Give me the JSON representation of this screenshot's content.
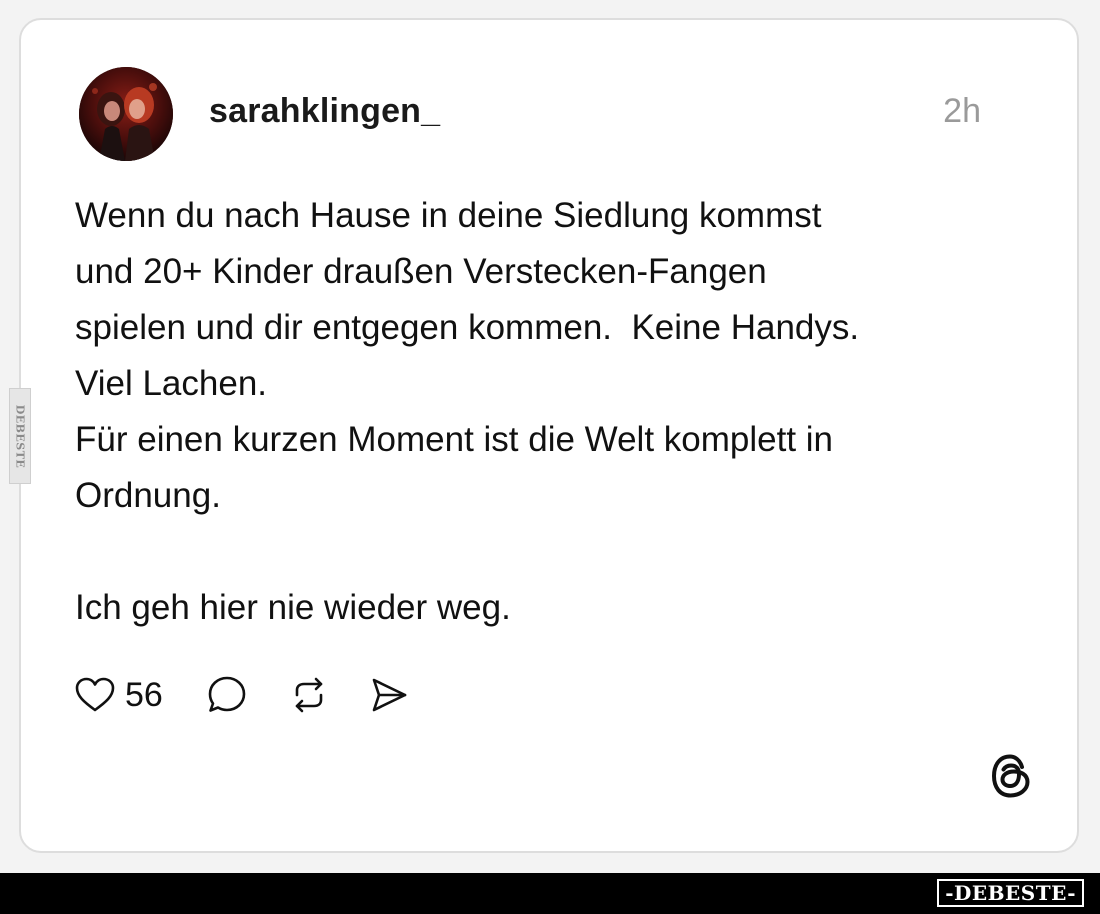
{
  "post": {
    "username": "sarahklingen_",
    "timestamp": "2h",
    "lines": [
      "Wenn du nach Hause in deine Siedlung kommst",
      "und 20+ Kinder draußen Verstecken-Fangen",
      "spielen und dir entgegen kommen.  Keine Handys.",
      "Viel Lachen.",
      "Für einen kurzen Moment ist die Welt komplett in",
      "Ordnung.",
      "Ich geh hier nie wieder weg."
    ],
    "like_count": "56"
  },
  "watermark": {
    "side_text": "DEBESTE",
    "badge_text": "-DEBESTE-"
  },
  "icons": {
    "like": "heart-icon",
    "comment": "comment-bubble-icon",
    "repost": "repost-icon",
    "share": "send-icon",
    "app": "threads-logo-icon"
  },
  "colors": {
    "card_background": "#ffffff",
    "page_background": "#f3f3f3",
    "text": "#111111",
    "muted": "#9a9a9a",
    "footer_bar": "#000000"
  }
}
